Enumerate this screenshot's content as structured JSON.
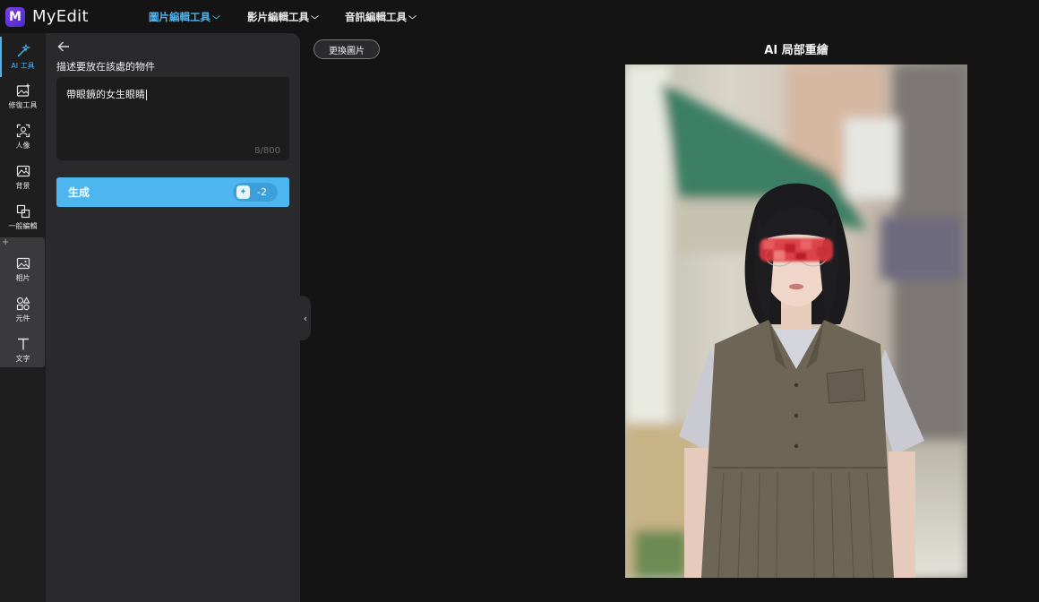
{
  "app": {
    "logo_letter": "M",
    "name": "MyEdit"
  },
  "top_nav": [
    {
      "label": "圖片編輯工具",
      "active": true
    },
    {
      "label": "影片編輯工具",
      "active": false
    },
    {
      "label": "音訊編輯工具",
      "active": false
    }
  ],
  "rail": {
    "ai_tools": "AI 工具",
    "repair": "修復工具",
    "portrait": "人像",
    "background": "背景",
    "general_edit": "一般編輯",
    "photo": "相片",
    "elements": "元件",
    "text": "文字"
  },
  "panel": {
    "title": "描述要放在該處的物件",
    "prompt_value": "帶眼鏡的女生眼睛",
    "counter": "8/800",
    "generate_label": "生成",
    "credit_cost": "-2"
  },
  "canvas": {
    "replace_button": "更換圖片",
    "title": "AI 局部重繪"
  },
  "colors": {
    "accent": "#4eb6ef",
    "brand": "#6a36e0",
    "mask": "#e0303a"
  }
}
